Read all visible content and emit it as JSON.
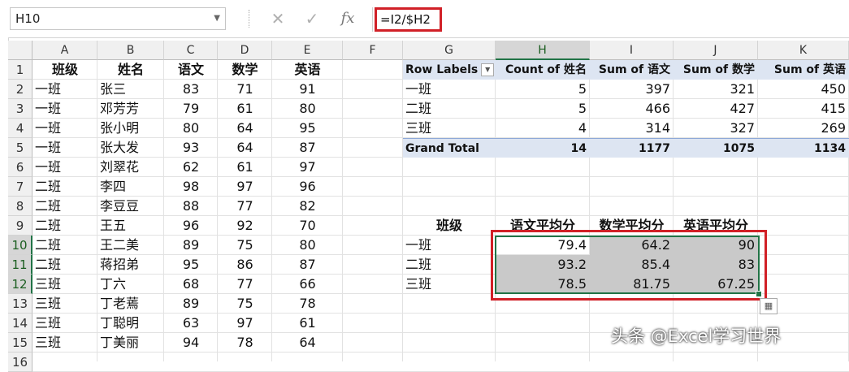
{
  "formula_bar": {
    "name_box": "H10",
    "formula": "=I2/$H2",
    "cancel_icon": "✕",
    "enter_icon": "✓",
    "fx_label": "fx"
  },
  "columns": [
    "A",
    "B",
    "C",
    "D",
    "E",
    "F",
    "G",
    "H",
    "I",
    "J",
    "K"
  ],
  "rows": [
    "1",
    "2",
    "3",
    "4",
    "5",
    "6",
    "7",
    "8",
    "9",
    "10",
    "11",
    "12",
    "13",
    "14",
    "15",
    "16"
  ],
  "table": {
    "headers": [
      "班级",
      "姓名",
      "语文",
      "数学",
      "英语"
    ],
    "rows": [
      [
        "一班",
        "张三",
        "83",
        "71",
        "91"
      ],
      [
        "一班",
        "邓芳芳",
        "79",
        "61",
        "80"
      ],
      [
        "一班",
        "张小明",
        "80",
        "64",
        "95"
      ],
      [
        "一班",
        "张大发",
        "93",
        "64",
        "87"
      ],
      [
        "一班",
        "刘翠花",
        "62",
        "61",
        "97"
      ],
      [
        "二班",
        "李四",
        "98",
        "97",
        "96"
      ],
      [
        "二班",
        "李豆豆",
        "88",
        "77",
        "82"
      ],
      [
        "二班",
        "王五",
        "96",
        "92",
        "70"
      ],
      [
        "二班",
        "王二美",
        "89",
        "75",
        "80"
      ],
      [
        "二班",
        "蒋招弟",
        "95",
        "86",
        "87"
      ],
      [
        "三班",
        "丁六",
        "68",
        "77",
        "66"
      ],
      [
        "三班",
        "丁老蔫",
        "89",
        "75",
        "78"
      ],
      [
        "三班",
        "丁聪明",
        "63",
        "97",
        "61"
      ],
      [
        "三班",
        "丁美丽",
        "94",
        "78",
        "64"
      ]
    ]
  },
  "pivot": {
    "headers": [
      "Row Labels",
      "Count of 姓名",
      "Sum of 语文",
      "Sum of 数学",
      "Sum of 英语"
    ],
    "rows": [
      [
        "一班",
        "5",
        "397",
        "321",
        "450"
      ],
      [
        "二班",
        "5",
        "466",
        "427",
        "415"
      ],
      [
        "三班",
        "4",
        "314",
        "327",
        "269"
      ]
    ],
    "total": [
      "Grand Total",
      "14",
      "1177",
      "1075",
      "1134"
    ]
  },
  "avg_table": {
    "headers": [
      "班级",
      "语文平均分",
      "数学平均分",
      "英语平均分"
    ],
    "rows": [
      [
        "一班",
        "79.4",
        "64.2",
        "90"
      ],
      [
        "二班",
        "93.2",
        "85.4",
        "83"
      ],
      [
        "三班",
        "78.5",
        "81.75",
        "67.25"
      ]
    ]
  },
  "selection": {
    "active_cell": "H10",
    "selected_column": "H",
    "selected_rows": [
      "10",
      "11",
      "12"
    ]
  },
  "colors": {
    "accent": "#217346",
    "highlight": "#d12027",
    "pivot_header": "#dde5f2"
  },
  "watermark": "头条 @Excel学习世界"
}
